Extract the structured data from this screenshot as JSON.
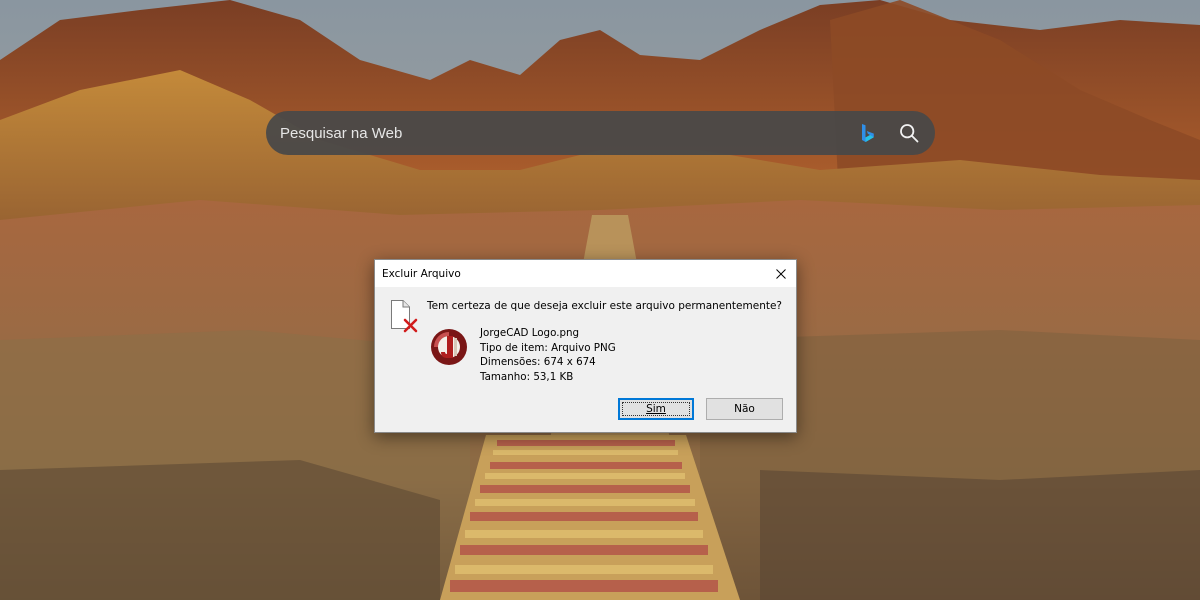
{
  "search": {
    "placeholder": "Pesquisar na Web",
    "icons": [
      "bing-icon",
      "search-icon"
    ]
  },
  "dialog": {
    "title": "Excluir Arquivo",
    "question": "Tem certeza de que deseja excluir este arquivo permanentemente?",
    "file": {
      "name": "JorgeCAD Logo.png",
      "type": "Tipo de item: Arquivo PNG",
      "dimensions": "Dimensões: 674 x 674",
      "size": "Tamanho: 53,1 KB"
    },
    "yes_label": "Sim",
    "no_label": "Não",
    "accent_color": "#0078d7"
  }
}
